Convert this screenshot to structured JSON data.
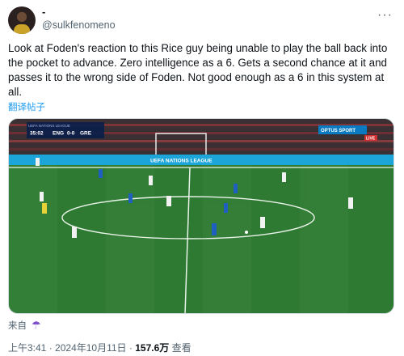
{
  "author": {
    "display_name": "-",
    "handle": "@sulkfenomeno"
  },
  "more_icon": "more-horizontal-icon",
  "tweet": {
    "text": "Look at Foden's reaction to this Rice guy being unable to play the ball back into the pocket to advance. Zero intelligence as a 6. Gets a second chance at it and passes it to the wrong side of Foden. Not good enough as a 6 in this system at all.",
    "translate_label": "翻译帖子"
  },
  "media": {
    "scoreboard": {
      "league": "UEFA NATIONS LEAGUE",
      "time": "35:02",
      "home": "ENG",
      "score": "0-0",
      "away": "GRE"
    },
    "broadcaster": {
      "name": "OPTUS SPORT",
      "live": "LIVE"
    },
    "board_text": "UEFA NATIONS LEAGUE",
    "colors": {
      "pitch": "#2f7a33",
      "pitch_stripe": "#357f38",
      "home_kit": "#f2f2f2",
      "away_kit": "#1f5fbf",
      "referee_kit": "#e8d23a"
    }
  },
  "footer": {
    "source_label": "来自",
    "source_icon": "umbrella-icon",
    "time": "上午3:41",
    "separator": "·",
    "date": "2024年10月11日",
    "views_count": "157.6万",
    "views_label": "查看"
  }
}
